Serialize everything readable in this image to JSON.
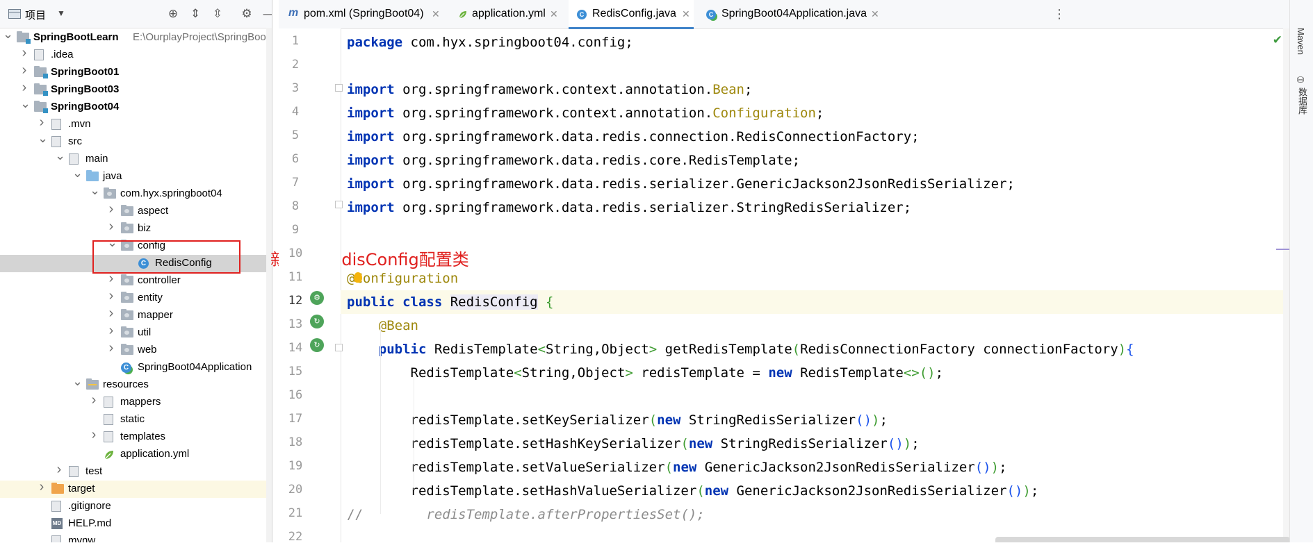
{
  "project_panel": {
    "title": "项目",
    "tree": [
      {
        "label": "SpringBootLearn",
        "path": "E:\\OurplayProject\\SpringBootL",
        "bold": true,
        "chevron": "v",
        "level": 0,
        "icon": "folder-module"
      },
      {
        "label": ".idea",
        "chevron": ">",
        "level": 1,
        "icon": "folder"
      },
      {
        "label": "SpringBoot01",
        "bold": true,
        "chevron": ">",
        "level": 1,
        "icon": "folder-module"
      },
      {
        "label": "SpringBoot03",
        "bold": true,
        "chevron": ">",
        "level": 1,
        "icon": "folder-module"
      },
      {
        "label": "SpringBoot04",
        "bold": true,
        "chevron": "v",
        "level": 1,
        "icon": "folder-module"
      },
      {
        "label": ".mvn",
        "chevron": ">",
        "level": 2,
        "icon": "folder"
      },
      {
        "label": "src",
        "chevron": "v",
        "level": 2,
        "icon": "folder"
      },
      {
        "label": "main",
        "chevron": "v",
        "level": 3,
        "icon": "folder"
      },
      {
        "label": "java",
        "chevron": "v",
        "level": 4,
        "icon": "folder-source"
      },
      {
        "label": "com.hyx.springboot04",
        "chevron": "v",
        "level": 5,
        "icon": "folder-package"
      },
      {
        "label": "aspect",
        "chevron": ">",
        "level": 6,
        "icon": "folder-package"
      },
      {
        "label": "biz",
        "chevron": ">",
        "level": 6,
        "icon": "folder-package"
      },
      {
        "label": "config",
        "chevron": "v",
        "level": 6,
        "icon": "folder-package"
      },
      {
        "label": "RedisConfig",
        "chevron": "",
        "level": 7,
        "icon": "class",
        "selected": true
      },
      {
        "label": "controller",
        "chevron": ">",
        "level": 6,
        "icon": "folder-package"
      },
      {
        "label": "entity",
        "chevron": ">",
        "level": 6,
        "icon": "folder-package"
      },
      {
        "label": "mapper",
        "chevron": ">",
        "level": 6,
        "icon": "folder-package"
      },
      {
        "label": "util",
        "chevron": ">",
        "level": 6,
        "icon": "folder-package"
      },
      {
        "label": "web",
        "chevron": ">",
        "level": 6,
        "icon": "folder-package"
      },
      {
        "label": "SpringBoot04Application",
        "chevron": "",
        "level": 6,
        "icon": "app-class"
      },
      {
        "label": "resources",
        "chevron": "v",
        "level": 4,
        "icon": "folder-resources"
      },
      {
        "label": "mappers",
        "chevron": ">",
        "level": 5,
        "icon": "folder"
      },
      {
        "label": "static",
        "chevron": "",
        "level": 5,
        "icon": "folder"
      },
      {
        "label": "templates",
        "chevron": ">",
        "level": 5,
        "icon": "folder"
      },
      {
        "label": "application.yml",
        "chevron": "",
        "level": 5,
        "icon": "yml"
      },
      {
        "label": "test",
        "chevron": ">",
        "level": 3,
        "icon": "folder"
      },
      {
        "label": "target",
        "chevron": ">",
        "level": 2,
        "icon": "folder-excluded",
        "highlight": true
      },
      {
        "label": ".gitignore",
        "chevron": "",
        "level": 2,
        "icon": "file"
      },
      {
        "label": "HELP.md",
        "chevron": "",
        "level": 2,
        "icon": "md"
      },
      {
        "label": "mvnw",
        "chevron": "",
        "level": 2,
        "icon": "file"
      }
    ]
  },
  "annotation": {
    "text": "新建的RedisConfig配置类",
    "color": "#e0211f"
  },
  "tabs": [
    {
      "label": "pom.xml (SpringBoot04)",
      "icon": "maven-icon",
      "active": false
    },
    {
      "label": "application.yml",
      "icon": "spring-leaf-icon",
      "active": false
    },
    {
      "label": "RedisConfig.java",
      "icon": "class-icon",
      "active": true
    },
    {
      "label": "SpringBoot04Application.java",
      "icon": "app-class-icon",
      "active": false
    }
  ],
  "right_strip": {
    "maven_label": "Maven",
    "database_label": "数据库"
  },
  "editor": {
    "current_line": 12,
    "lines": [
      {
        "n": "1",
        "tokens": [
          [
            "kw",
            "package"
          ],
          [
            "ty",
            " com.hyx.springboot04.config;"
          ]
        ]
      },
      {
        "n": "2",
        "tokens": []
      },
      {
        "n": "3",
        "tokens": [
          [
            "kw",
            "import"
          ],
          [
            "ty",
            " org.springframework.context.annotation."
          ],
          [
            "ann",
            "Bean"
          ],
          [
            "ty",
            ";"
          ]
        ]
      },
      {
        "n": "4",
        "tokens": [
          [
            "kw",
            "import"
          ],
          [
            "ty",
            " org.springframework.context.annotation."
          ],
          [
            "ann",
            "Configuration"
          ],
          [
            "ty",
            ";"
          ]
        ]
      },
      {
        "n": "5",
        "tokens": [
          [
            "kw",
            "import"
          ],
          [
            "ty",
            " org.springframework.data.redis.connection.RedisConnectionFactory;"
          ]
        ]
      },
      {
        "n": "6",
        "tokens": [
          [
            "kw",
            "import"
          ],
          [
            "ty",
            " org.springframework.data.redis.core.RedisTemplate;"
          ]
        ]
      },
      {
        "n": "7",
        "tokens": [
          [
            "kw",
            "import"
          ],
          [
            "ty",
            " org.springframework.data.redis.serializer.GenericJackson2JsonRedisSerializer;"
          ]
        ]
      },
      {
        "n": "8",
        "tokens": [
          [
            "kw",
            "import"
          ],
          [
            "ty",
            " org.springframework.data.redis.serializer.StringRedisSerializer;"
          ]
        ]
      },
      {
        "n": "9",
        "tokens": []
      },
      {
        "n": "10",
        "tokens": []
      },
      {
        "n": "11",
        "tokens": [
          [
            "ann",
            "@Configuration"
          ]
        ]
      },
      {
        "n": "12",
        "tokens": [
          [
            "kw",
            "public class"
          ],
          [
            "ty",
            " "
          ],
          [
            "cls-hl",
            "RedisConfig"
          ],
          [
            "ty",
            " "
          ],
          [
            "p-green",
            "{"
          ]
        ]
      },
      {
        "n": "13",
        "tokens": [
          [
            "ty",
            "    "
          ],
          [
            "ann",
            "@Bean"
          ]
        ]
      },
      {
        "n": "14",
        "tokens": [
          [
            "ty",
            "    "
          ],
          [
            "kw",
            "public"
          ],
          [
            "ty",
            " RedisTemplate"
          ],
          [
            "p-green",
            "<"
          ],
          [
            "ty",
            "String,Object"
          ],
          [
            "p-green",
            ">"
          ],
          [
            "ty",
            " getRedisTemplate"
          ],
          [
            "p-green",
            "("
          ],
          [
            "ty",
            "RedisConnectionFactory connectionFactory"
          ],
          [
            "p-green",
            ")"
          ],
          [
            "p-blue",
            "{"
          ]
        ]
      },
      {
        "n": "15",
        "tokens": [
          [
            "ty",
            "        RedisTemplate"
          ],
          [
            "p-green",
            "<"
          ],
          [
            "ty",
            "String,Object"
          ],
          [
            "p-green",
            ">"
          ],
          [
            "ty",
            " redisTemplate = "
          ],
          [
            "kw",
            "new"
          ],
          [
            "ty",
            " RedisTemplate"
          ],
          [
            "p-green",
            "<>"
          ],
          [
            "p-green",
            "()"
          ],
          [
            "ty",
            ";"
          ]
        ]
      },
      {
        "n": "16",
        "tokens": []
      },
      {
        "n": "17",
        "tokens": [
          [
            "ty",
            "        redisTemplate.setKeySerializer"
          ],
          [
            "p-green",
            "("
          ],
          [
            "kw",
            "new"
          ],
          [
            "ty",
            " StringRedisSerializer"
          ],
          [
            "p-blue",
            "()"
          ],
          [
            "p-green",
            ")"
          ],
          [
            "ty",
            ";"
          ]
        ]
      },
      {
        "n": "18",
        "tokens": [
          [
            "ty",
            "        redisTemplate.setHashKeySerializer"
          ],
          [
            "p-green",
            "("
          ],
          [
            "kw",
            "new"
          ],
          [
            "ty",
            " StringRedisSerializer"
          ],
          [
            "p-blue",
            "()"
          ],
          [
            "p-green",
            ")"
          ],
          [
            "ty",
            ";"
          ]
        ]
      },
      {
        "n": "19",
        "tokens": [
          [
            "ty",
            "        redisTemplate.setValueSerializer"
          ],
          [
            "p-green",
            "("
          ],
          [
            "kw",
            "new"
          ],
          [
            "ty",
            " GenericJackson2JsonRedisSerializer"
          ],
          [
            "p-blue",
            "()"
          ],
          [
            "p-green",
            ")"
          ],
          [
            "ty",
            ";"
          ]
        ]
      },
      {
        "n": "20",
        "tokens": [
          [
            "ty",
            "        redisTemplate.setHashValueSerializer"
          ],
          [
            "p-green",
            "("
          ],
          [
            "kw",
            "new"
          ],
          [
            "ty",
            " GenericJackson2JsonRedisSerializer"
          ],
          [
            "p-blue",
            "()"
          ],
          [
            "p-green",
            ")"
          ],
          [
            "ty",
            ";"
          ]
        ]
      },
      {
        "n": "21",
        "tokens": [
          [
            "cm",
            "//"
          ],
          [
            "ty",
            "        "
          ],
          [
            "cm-it",
            "redisTemplate.afterPropertiesSet();"
          ]
        ]
      },
      {
        "n": "22",
        "tokens": []
      }
    ]
  }
}
